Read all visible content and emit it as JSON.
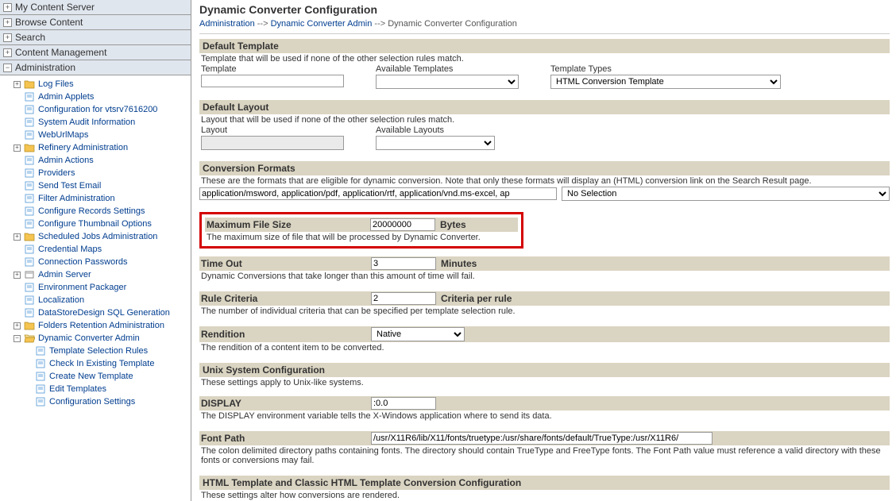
{
  "sidebar": {
    "sections": {
      "myContentServer": "My Content Server",
      "browseContent": "Browse Content",
      "search": "Search",
      "contentManagement": "Content Management",
      "administration": "Administration"
    },
    "admin": {
      "logFiles": "Log Files",
      "adminApplets": "Admin Applets",
      "configFor": "Configuration for vtsrv7616200",
      "systemAudit": "System Audit Information",
      "webUrlMaps": "WebUrlMaps",
      "refineryAdmin": "Refinery Administration",
      "adminActions": "Admin Actions",
      "providers": "Providers",
      "sendTestEmail": "Send Test Email",
      "filterAdmin": "Filter Administration",
      "configRecords": "Configure Records Settings",
      "configThumbnail": "Configure Thumbnail Options",
      "scheduledJobs": "Scheduled Jobs Administration",
      "credentialMaps": "Credential Maps",
      "connectionPasswords": "Connection Passwords",
      "adminServer": "Admin Server",
      "envPackager": "Environment Packager",
      "localization": "Localization",
      "dataStoreDesign": "DataStoreDesign SQL Generation",
      "foldersRetention": "Folders Retention Administration",
      "dynamicConverterAdmin": "Dynamic Converter Admin",
      "templateSelectionRules": "Template Selection Rules",
      "checkInExisting": "Check In Existing Template",
      "createNewTemplate": "Create New Template",
      "editTemplates": "Edit Templates",
      "configSettings": "Configuration Settings"
    }
  },
  "page": {
    "title": "Dynamic Converter Configuration",
    "breadcrumb": {
      "administration": "Administration",
      "dynamicConverterAdmin": "Dynamic Converter Admin",
      "current": "Dynamic Converter Configuration",
      "sep": "-->"
    }
  },
  "defaultTemplate": {
    "title": "Default Template",
    "desc": "Template that will be used if none of the other selection rules match.",
    "templateLabel": "Template",
    "templateValue": "",
    "availableLabel": "Available Templates",
    "typesLabel": "Template Types",
    "typesValue": "HTML Conversion Template"
  },
  "defaultLayout": {
    "title": "Default Layout",
    "desc": "Layout that will be used if none of the other selection rules match.",
    "layoutLabel": "Layout",
    "availableLabel": "Available Layouts"
  },
  "conversionFormats": {
    "title": "Conversion Formats",
    "desc": "These are the formats that are eligible for dynamic conversion. Note that only these formats will display an (HTML) conversion link on the Search Result page.",
    "value": "application/msword, application/pdf, application/rtf, application/vnd.ms-excel, ap",
    "noSelection": "No Selection"
  },
  "maxFileSize": {
    "label": "Maximum File Size",
    "value": "20000000",
    "unit": "Bytes",
    "desc": "The maximum size of file that will be processed by Dynamic Converter."
  },
  "timeOut": {
    "label": "Time Out",
    "value": "3",
    "unit": "Minutes",
    "desc": "Dynamic Conversions that take longer than this amount of time will fail."
  },
  "ruleCriteria": {
    "label": "Rule Criteria",
    "value": "2",
    "unit": "Criteria per rule",
    "desc": "The number of individual criteria that can be specified per template selection rule."
  },
  "rendition": {
    "label": "Rendition",
    "value": "Native",
    "desc": "The rendition of a content item to be converted."
  },
  "unix": {
    "title": "Unix System Configuration",
    "desc": "These settings apply to Unix-like systems."
  },
  "display": {
    "label": "DISPLAY",
    "value": ":0.0",
    "desc": "The DISPLAY environment variable tells the X-Windows application where to send its data."
  },
  "fontPath": {
    "label": "Font Path",
    "value": "/usr/X11R6/lib/X11/fonts/truetype:/usr/share/fonts/default/TrueType:/usr/X11R6/",
    "desc": "The colon delimited directory paths containing fonts. The directory should contain TrueType and FreeType fonts. The Font Path value must reference a valid directory with these fonts or conversions may fail."
  },
  "htmlTemplate": {
    "title": "HTML Template and Classic HTML Template Conversion Configuration",
    "desc": "These settings alter how conversions are rendered."
  }
}
